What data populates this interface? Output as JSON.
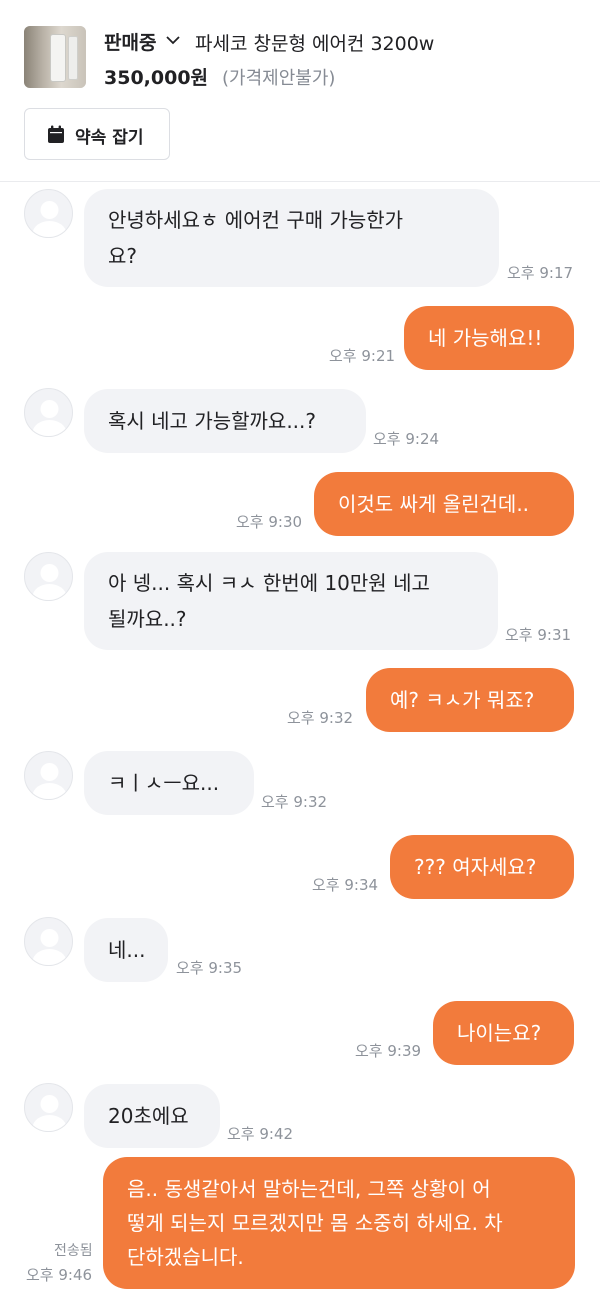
{
  "header": {
    "status": "판매중",
    "title": "파세코 창문형 에어컨 3200w",
    "price": "350,000원",
    "price_note": "(가격제안불가)",
    "appointment_label": "약속 잡기"
  },
  "messages": [
    {
      "from": "other",
      "lines": [
        "안녕하세요ㅎ 에어컨 구매 가능한가",
        "요?"
      ],
      "time": "오후 9:17"
    },
    {
      "from": "me",
      "lines": [
        "네 가능해요!!"
      ],
      "time": "오후 9:21"
    },
    {
      "from": "other",
      "lines": [
        "혹시 네고 가능할까요...?"
      ],
      "time": "오후 9:24"
    },
    {
      "from": "me",
      "lines": [
        "이것도 싸게 올린건데.."
      ],
      "time": "오후 9:30"
    },
    {
      "from": "other",
      "lines": [
        "아 넹... 혹시 ㅋㅅ 한번에 10만원 네고",
        "될까요..?"
      ],
      "time": "오후 9:31"
    },
    {
      "from": "me",
      "lines": [
        "예? ㅋㅅ가 뭐죠?"
      ],
      "time": "오후 9:32"
    },
    {
      "from": "other",
      "lines": [
        "ㅋㅣㅅㅡ요..."
      ],
      "time": "오후 9:32"
    },
    {
      "from": "me",
      "lines": [
        "??? 여자세요?"
      ],
      "time": "오후 9:34"
    },
    {
      "from": "other",
      "lines": [
        "네..."
      ],
      "time": "오후 9:35"
    },
    {
      "from": "me",
      "lines": [
        "나이는요?"
      ],
      "time": "오후 9:39"
    },
    {
      "from": "other",
      "lines": [
        "20초에요"
      ],
      "time": "오후 9:42"
    },
    {
      "from": "me",
      "lines": [
        "음.. 동생같아서 말하는건데, 그쪽 상황이 어",
        "떻게 되는지 모르겠지만 몸 소중히 하세요. 차",
        "단하겠습니다."
      ],
      "time": "오후 9:46",
      "status": "전송됨"
    }
  ],
  "colors": {
    "accent": "#f27b3c",
    "incoming_bubble": "#f2f3f6",
    "timestamp": "#8e939b"
  }
}
